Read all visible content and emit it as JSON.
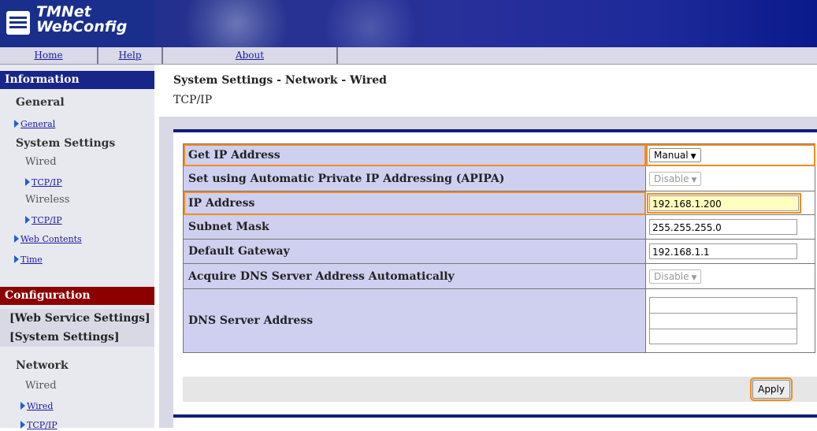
{
  "header": {
    "logo_line1": "TMNet",
    "logo_line2": "WebConfig"
  },
  "topnav": {
    "home": "Home",
    "help": "Help",
    "about": "About"
  },
  "sidebar": {
    "information": "Information",
    "general_group": "General",
    "general_link": "General",
    "system_settings_group": "System Settings",
    "wired": "Wired",
    "wired_tcpip": "TCP/IP",
    "wireless": "Wireless",
    "wireless_tcpip": "TCP/IP",
    "web_contents": "Web Contents",
    "time": "Time",
    "configuration": "Configuration",
    "web_service_settings": "[Web Service Settings]",
    "system_settings_bracket": "[System Settings]",
    "network_group": "Network",
    "net_wired": "Wired",
    "net_wired_link": "Wired",
    "net_tcpip_link": "TCP/IP"
  },
  "content": {
    "breadcrumb": "System Settings - Network - Wired",
    "subtitle": "TCP/IP",
    "rows": {
      "get_ip_label": "Get IP Address",
      "get_ip_value": "Manual",
      "apipa_label": "Set using Automatic Private IP Addressing (APIPA)",
      "apipa_value": "Disable",
      "ip_label": "IP Address",
      "ip_value": "192.168.1.200",
      "subnet_label": "Subnet Mask",
      "subnet_value": "255.255.255.0",
      "gateway_label": "Default Gateway",
      "gateway_value": "192.168.1.1",
      "dns_auto_label": "Acquire DNS Server Address Automatically",
      "dns_auto_value": "Disable",
      "dns_label": "DNS Server Address",
      "dns_values": [
        "",
        "",
        ""
      ]
    },
    "apply": "Apply"
  },
  "colors": {
    "highlight": "#f08c20",
    "nav_blue": "#18268a",
    "config_red": "#8c0000",
    "label_bg": "#cfcff0"
  }
}
